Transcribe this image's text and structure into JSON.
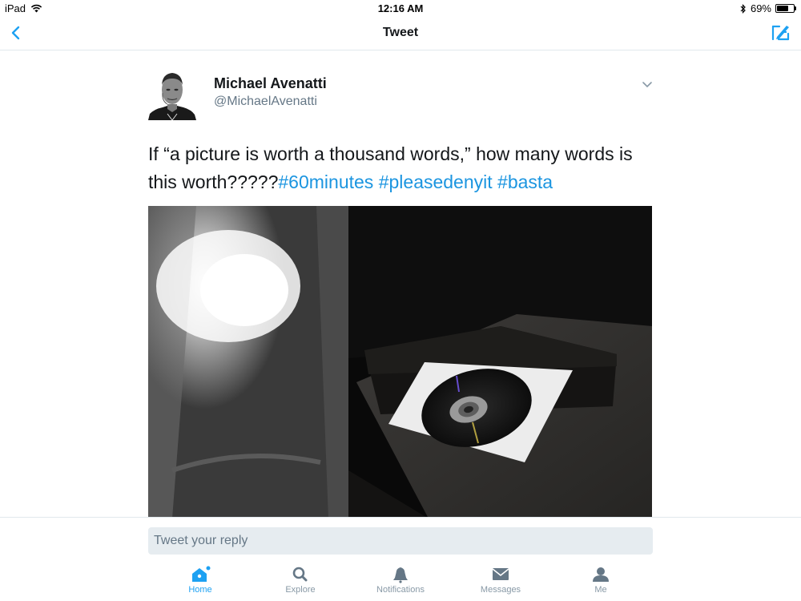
{
  "status_bar": {
    "device": "iPad",
    "time": "12:16 AM",
    "battery_percent": "69%",
    "battery_level": 0.69
  },
  "nav": {
    "title": "Tweet"
  },
  "tweet": {
    "author_name": "Michael Avenatti",
    "author_handle": "@MichaelAvenatti",
    "text_plain": "If “a picture is worth a thousand words,” how many words is this worth?????",
    "hashtags": [
      "#60minutes",
      "#pleasedenyit",
      "#basta"
    ]
  },
  "reply": {
    "placeholder": "Tweet your reply"
  },
  "tabs": [
    {
      "label": "Home",
      "icon": "home-icon",
      "active": true
    },
    {
      "label": "Explore",
      "icon": "search-icon",
      "active": false
    },
    {
      "label": "Notifications",
      "icon": "bell-icon",
      "active": false
    },
    {
      "label": "Messages",
      "icon": "envelope-icon",
      "active": false
    },
    {
      "label": "Me",
      "icon": "person-icon",
      "active": false
    }
  ],
  "colors": {
    "accent": "#1da1f2",
    "hashtag": "#1b95e0",
    "secondary_text": "#657786",
    "tab_inactive": "#8899a6"
  }
}
